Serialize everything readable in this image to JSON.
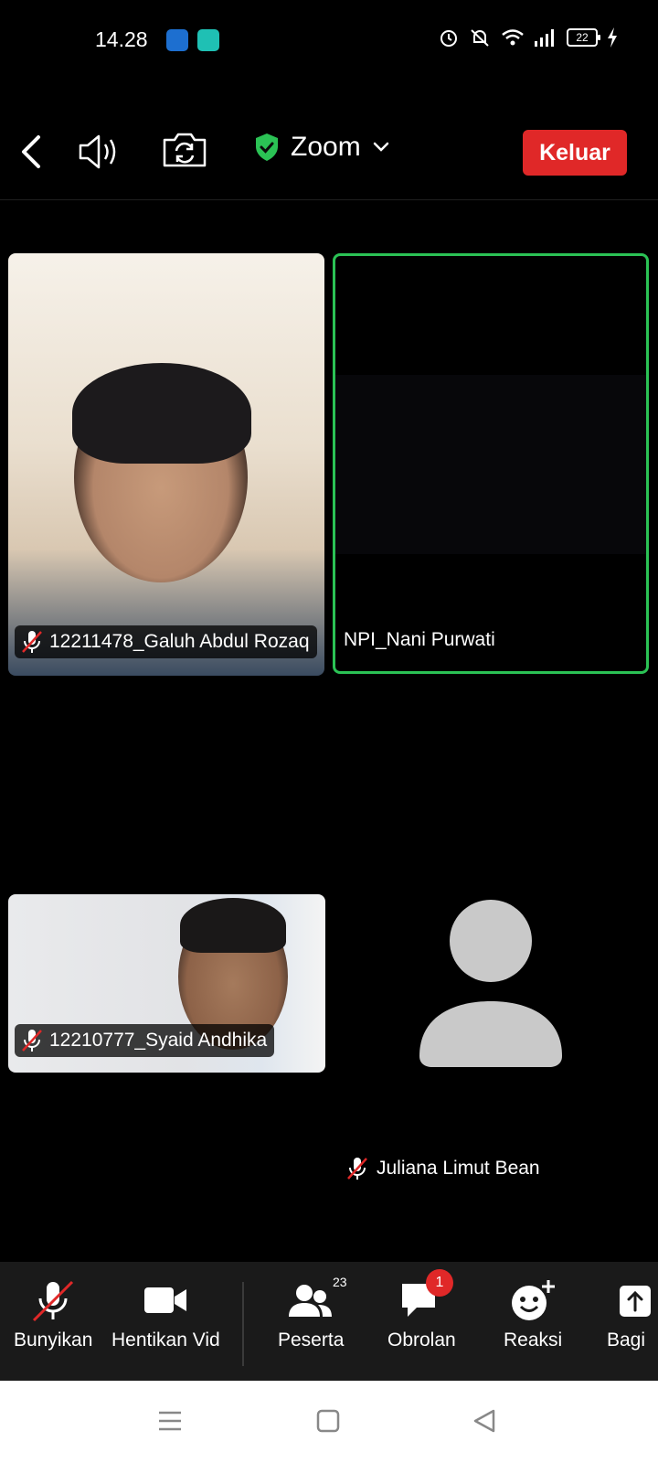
{
  "status_bar": {
    "time": "14.28",
    "battery": "22"
  },
  "top_bar": {
    "meeting_title": "Zoom",
    "leave_label": "Keluar"
  },
  "participants": [
    {
      "name": "12211478_Galuh Abdul Rozaq",
      "muted": true,
      "video": true
    },
    {
      "name": "NPI_Nani Purwati",
      "muted": false,
      "video": false,
      "active_speaker": true
    },
    {
      "name": "12210777_Syaid Andhika",
      "muted": true,
      "video": true
    },
    {
      "name": "Juliana Limut Bean",
      "muted": true,
      "video": false
    }
  ],
  "toolbar": {
    "unmute_label": "Bunyikan",
    "stop_video_label": "Hentikan Vid",
    "participants_label": "Peserta",
    "participants_count": "23",
    "chat_label": "Obrolan",
    "chat_unread": "1",
    "reactions_label": "Reaksi",
    "share_label": "Bagi"
  },
  "colors": {
    "leave": "#e02828",
    "active_speaker_border": "#2bc255",
    "shield": "#2bc255"
  }
}
